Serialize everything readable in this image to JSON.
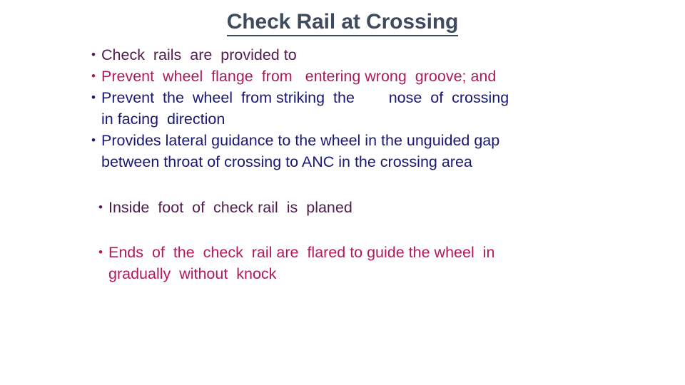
{
  "slide": {
    "title": "Check Rail at Crossing",
    "bullet_marker": "•",
    "colors": {
      "title": "#3e4a5e",
      "plum": "#521a50",
      "crimson": "#b01a5c",
      "navy": "#181878",
      "background": "#ffffff"
    },
    "bullets": [
      {
        "id": "check-rails-provided",
        "color": "plum",
        "lines": [
          "Check  rails  are  provided to"
        ]
      },
      {
        "id": "prevent-wheel-flange",
        "color": "crimson",
        "lines": [
          "Prevent  wheel  flange  from   entering wrong  groove; and"
        ]
      },
      {
        "id": "prevent-wheel-striking-nose",
        "color": "navy",
        "lines": [
          "Prevent  the  wheel  from striking  the        nose  of  crossing",
          "in facing  direction"
        ]
      },
      {
        "id": "provides-lateral-guidance",
        "color": "navy",
        "lines": [
          "Provides lateral guidance to the wheel in the unguided gap",
          "between throat of crossing to ANC in the crossing area"
        ]
      },
      {
        "id": "inside-foot-planed",
        "color": "plum",
        "lines": [
          "Inside  foot  of  check rail  is  planed"
        ]
      },
      {
        "id": "ends-flared",
        "color": "crimson",
        "lines": [
          "Ends  of  the  check  rail are  flared to guide the wheel  in",
          "gradually  without  knock"
        ]
      }
    ]
  }
}
